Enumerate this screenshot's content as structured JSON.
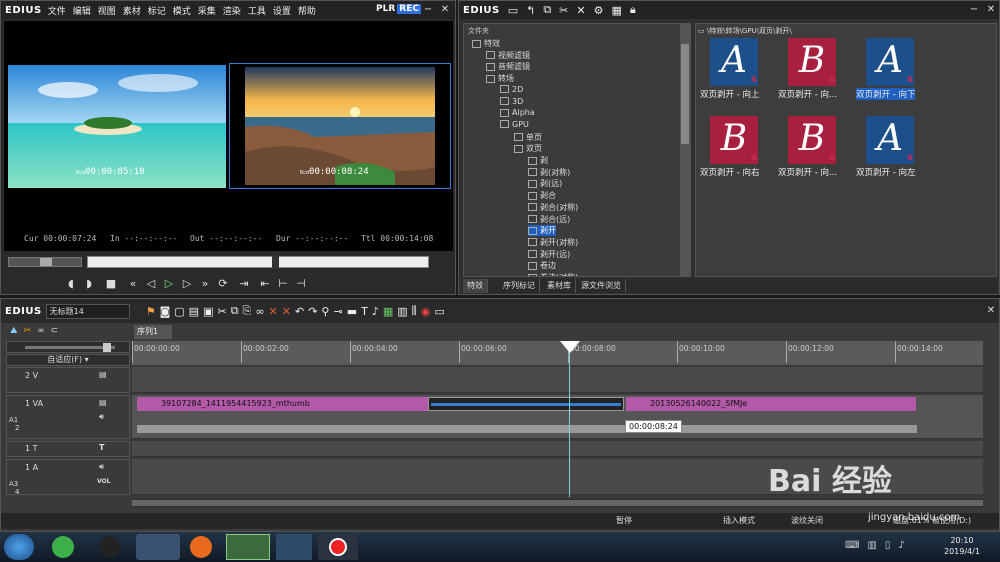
{
  "player": {
    "logo": "EDIUS",
    "menu": [
      "文件",
      "编辑",
      "视图",
      "素材",
      "标记",
      "模式",
      "采集",
      "渲染",
      "工具",
      "设置",
      "帮助"
    ],
    "plr": "PLR",
    "rec": "REC",
    "source_tc": "00:00:05:10",
    "record_tc": "00:00:08:24",
    "cur_label": "Cur",
    "cur_value": "00:00:07:24",
    "in_label": "In",
    "in_value": "--:--:--:--",
    "out_label": "Out",
    "out_value": "--:--:--:--",
    "dur_label": "Dur",
    "dur_value": "--:--:--:--",
    "ttl_label": "Ttl",
    "ttl_value": "00:00:14:08"
  },
  "bin": {
    "logo": "EDIUS",
    "folder_header": "文件夹",
    "path": "\\特效\\转场\\GPU\\双页\\剥开\\",
    "tree": [
      "特效",
      "视频滤镜",
      "音频滤镜",
      "转场",
      "2D",
      "3D",
      "Alpha",
      "GPU",
      "单页",
      "双页",
      "剥",
      "剥(对称)",
      "剥(远)",
      "剥合",
      "剥合(对称)",
      "剥合(远)",
      "剥开",
      "剥开(对称)",
      "剥开(远)",
      "卷边",
      "卷边(对称)"
    ],
    "thumbs": [
      {
        "letter": "A",
        "label": "双页剥开 - 向上",
        "color": "#cc2a55"
      },
      {
        "letter": "B",
        "label": "双页剥开 - 向...",
        "color": "#cc2a55"
      },
      {
        "letter": "A",
        "label": "双页剥开 - 向下",
        "color": "#cc2a55"
      },
      {
        "letter": "B",
        "label": "双页剥开 - 向右",
        "color": "#cc2a55"
      },
      {
        "letter": "B",
        "label": "双页剥开 - 向...",
        "color": "#cc2a55"
      },
      {
        "letter": "A",
        "label": "双页剥开 - 向左",
        "color": "#cc2a55"
      }
    ],
    "tabs": [
      "特效",
      "序列标记",
      "素材库",
      "源文件浏览"
    ]
  },
  "timeline": {
    "logo": "EDIUS",
    "project": "无标题14",
    "sequence_tab": "序列1",
    "mode": "自适应(F)",
    "ruler": [
      "00:00:00:00",
      "00:00:02:00",
      "00:00:04:00",
      "00:00:06:00",
      "00:00:08:00",
      "00:00:10:00",
      "00:00:12:00",
      "00:00:14:00"
    ],
    "tracks": {
      "v2": "2 V",
      "va1": "1 VA",
      "t1": "1 T",
      "a1": "1 A",
      "vol": "VOL",
      "a_label": "A",
      "track_num": "1",
      "track_num2": "2",
      "a_num": "3",
      "a_num2": "4"
    },
    "clip1": "39107284_1411954415923_mthumb",
    "clip2": "20130526140022_SfMJe",
    "tooltip": "00:00:08:24",
    "status_pause": "暂停",
    "status_insert": "插入模式",
    "status_ripple": "波纹关闭",
    "status_disk": "磁盘:61% 被使用(D:)"
  },
  "taskbar": {
    "time": "20:10",
    "date": "2019/4/1"
  },
  "watermark": {
    "text": "Bai 经验",
    "url": "jingyan.baidu.com"
  },
  "colors": {
    "accent": "#2266dd",
    "clip": "#b25aa8",
    "rec": "#2f6fe0",
    "playhead": "#7ad3d8"
  }
}
